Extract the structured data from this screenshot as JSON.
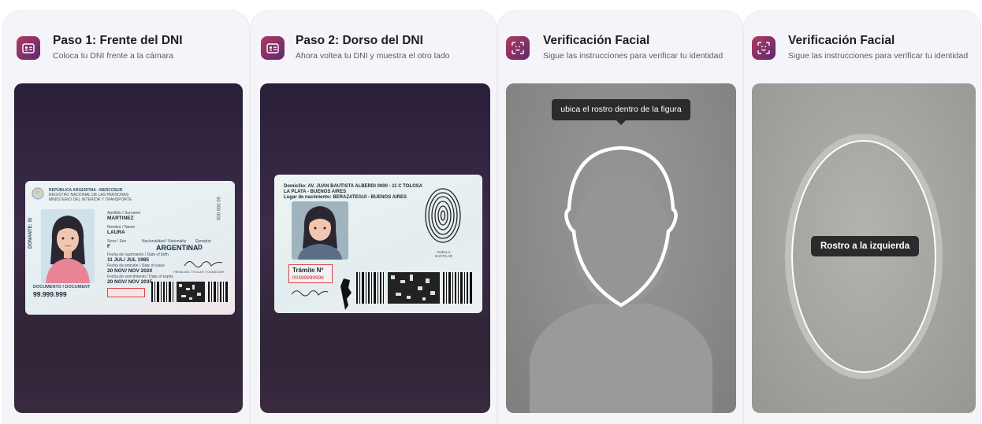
{
  "panels": [
    {
      "title": "Paso 1: Frente del DNI",
      "subtitle": "Coloca tu DNI frente a la cámara",
      "icon": "id-card-icon",
      "card_front": {
        "header1": "REPÚBLICA ARGENTINA - MERCOSUR",
        "header2": "REGISTRO NACIONAL DE LAS PERSONAS",
        "header3": "MINISTERIO DEL INTERIOR Y TRANSPORTE",
        "surname_label": "Apellido / Surname",
        "surname": "MARTINEZ",
        "name_label": "Nombre / Name",
        "name": "LAURA",
        "sex_label": "Sexo / Sex",
        "sex": "F",
        "nationality_label": "Nacionalidad / Nationality",
        "nationality": "ARGENTINA",
        "copy_label": "Ejemplar",
        "copy": "D",
        "birth_label": "Fecha de nacimiento / Date of birth",
        "birth": "11 JUL/ JUL 1985",
        "issue_label": "Fecha de emisión / Date of issue",
        "issue": "20 NOV/ NOV 2020",
        "expiry_label": "Fecha de vencimiento / Date of expiry",
        "expiry": "20 NOV/ NOV 2035",
        "doc_label": "DOCUMENTO / DOCUMENT",
        "doc_number": "99.999.999",
        "donor": "DONANTE: SI",
        "serial": "00 000 000",
        "signature_label": "FIRMA DEL TITULAR / SIGNATURE"
      }
    },
    {
      "title": "Paso 2: Dorso del DNI",
      "subtitle": "Ahora voltea tu DNI y muestra el otro lado",
      "icon": "id-card-icon",
      "card_back": {
        "address": "Domicilio: AV. JUAN BAUTISTA ALBERDI 0000 - 11 C TOLOSA",
        "city": "LA PLATA - BUENOS AIRES",
        "birthplace": "Lugar de nacimiento: BERAZATEGUI - BUENOS AIRES",
        "fingerprint_label": "HUELLA DACTILAR",
        "tramite_label": "Trámite Nº",
        "tramite": "00399999999"
      }
    },
    {
      "title": "Verificación Facial",
      "subtitle": "Sigue las instrucciones para verificar tu identidad",
      "icon": "face-scan-icon",
      "tooltip": "ubica el rostro dentro de la figura"
    },
    {
      "title": "Verificación Facial",
      "subtitle": "Sigue las instrucciones para verificar tu identidad",
      "icon": "face-scan-icon",
      "instruction": "Rostro a la izquierda"
    }
  ],
  "colors": {
    "icon_gradient_start": "#b23a63",
    "icon_gradient_end": "#5b2a6e",
    "panel_bg": "#f5f4f9",
    "tooltip_bg": "#2b2b2e"
  }
}
